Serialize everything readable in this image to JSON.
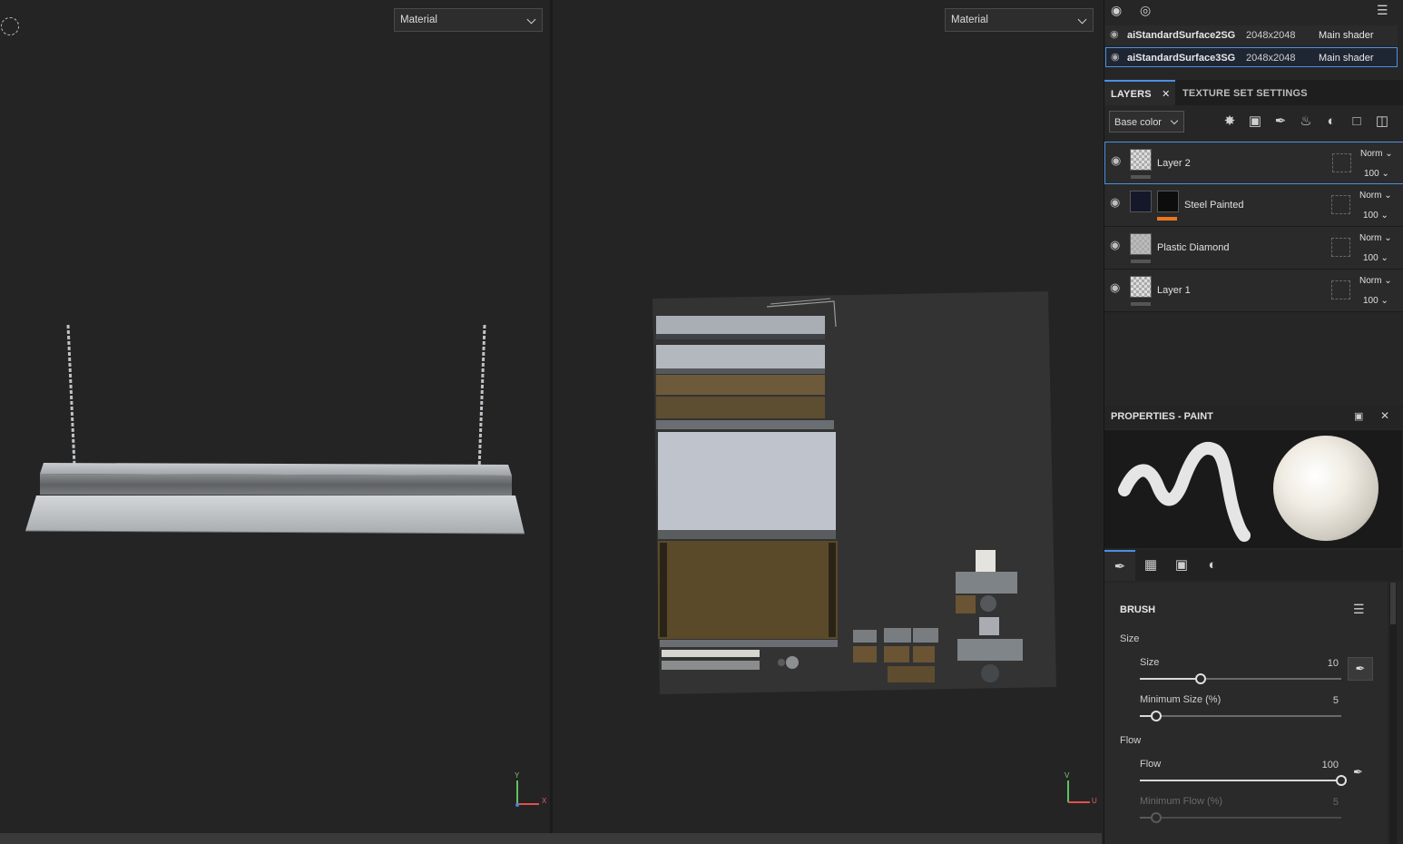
{
  "viewports": {
    "left": {
      "mode": "Material",
      "axis_y": "Y",
      "axis_x": "X"
    },
    "right": {
      "mode": "Material",
      "axis_y": "V",
      "axis_x": "U"
    }
  },
  "texture_sets": [
    {
      "name": "aiStandardSurface2SG",
      "resolution": "2048x2048",
      "shader": "Main shader",
      "selected": false
    },
    {
      "name": "aiStandardSurface3SG",
      "resolution": "2048x2048",
      "shader": "Main shader",
      "selected": true
    }
  ],
  "tabs": {
    "layers": "LAYERS",
    "texture_set_settings": "TEXTURE SET SETTINGS"
  },
  "channel": "Base color",
  "layers": [
    {
      "name": "Layer 2",
      "blend": "Norm",
      "opacity": "100"
    },
    {
      "name": "Steel Painted",
      "blend": "Norm",
      "opacity": "100"
    },
    {
      "name": "Plastic Diamond",
      "blend": "Norm",
      "opacity": "100"
    },
    {
      "name": "Layer 1",
      "blend": "Norm",
      "opacity": "100"
    }
  ],
  "properties": {
    "title": "PROPERTIES - PAINT",
    "brush": {
      "title": "BRUSH",
      "size_group": "Size",
      "size_label": "Size",
      "size_value": "10",
      "size_fraction": 0.3,
      "min_size_label": "Minimum Size (%)",
      "min_size_value": "5",
      "min_size_fraction": 0.08,
      "flow_group": "Flow",
      "flow_label": "Flow",
      "flow_value": "100",
      "flow_fraction": 1.0,
      "min_flow_label": "Minimum Flow (%)",
      "min_flow_value": "5",
      "min_flow_fraction": 0.08
    }
  },
  "colors": {
    "accent": "#4a90e2",
    "steel_bar": "#e87722"
  }
}
